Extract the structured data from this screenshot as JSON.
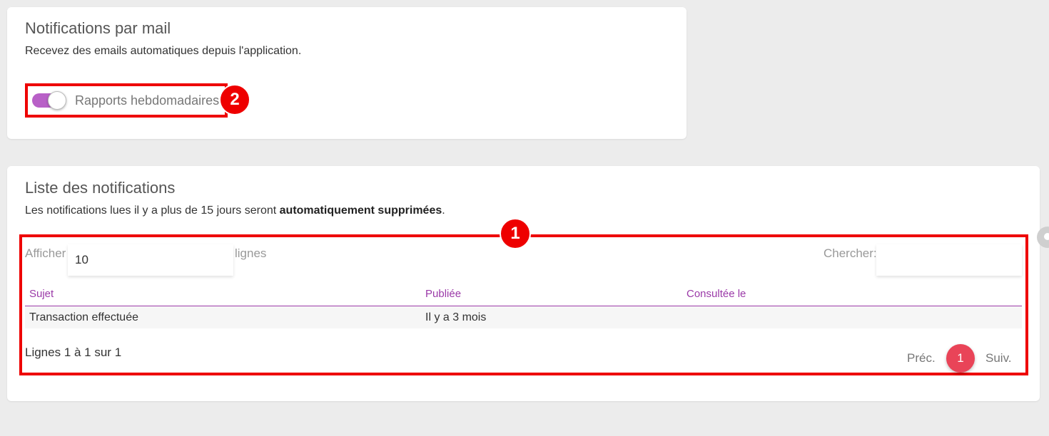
{
  "mail_card": {
    "title": "Notifications par mail",
    "description": "Recevez des emails automatiques depuis l'application.",
    "toggle_label": "Rapports hebdomadaires",
    "toggle_state": true,
    "annotation_number": "2"
  },
  "list_card": {
    "title": "Liste des notifications",
    "description_prefix": "Les notifications lues il y a plus de 15 jours seront ",
    "description_bold": "automatiquement supprimées",
    "description_suffix": ".",
    "annotation_number": "1",
    "show_label": "Afficher",
    "show_value": "10",
    "rows_label": "lignes",
    "search_label": "Chercher:",
    "search_value": "",
    "columns": [
      "Sujet",
      "Publiée",
      "Consultée le"
    ],
    "rows": [
      [
        "Transaction effectuée",
        "Il y a 3 mois",
        ""
      ]
    ],
    "info": "Lignes 1 à 1 sur 1",
    "prev_label": "Préc.",
    "next_label": "Suiv.",
    "current_page": "1"
  },
  "colors": {
    "accent": "#9b3aa8",
    "toggle": "#b860c7",
    "page_badge": "#e94458",
    "annotation": "#ee0000",
    "background": "#ececec"
  }
}
